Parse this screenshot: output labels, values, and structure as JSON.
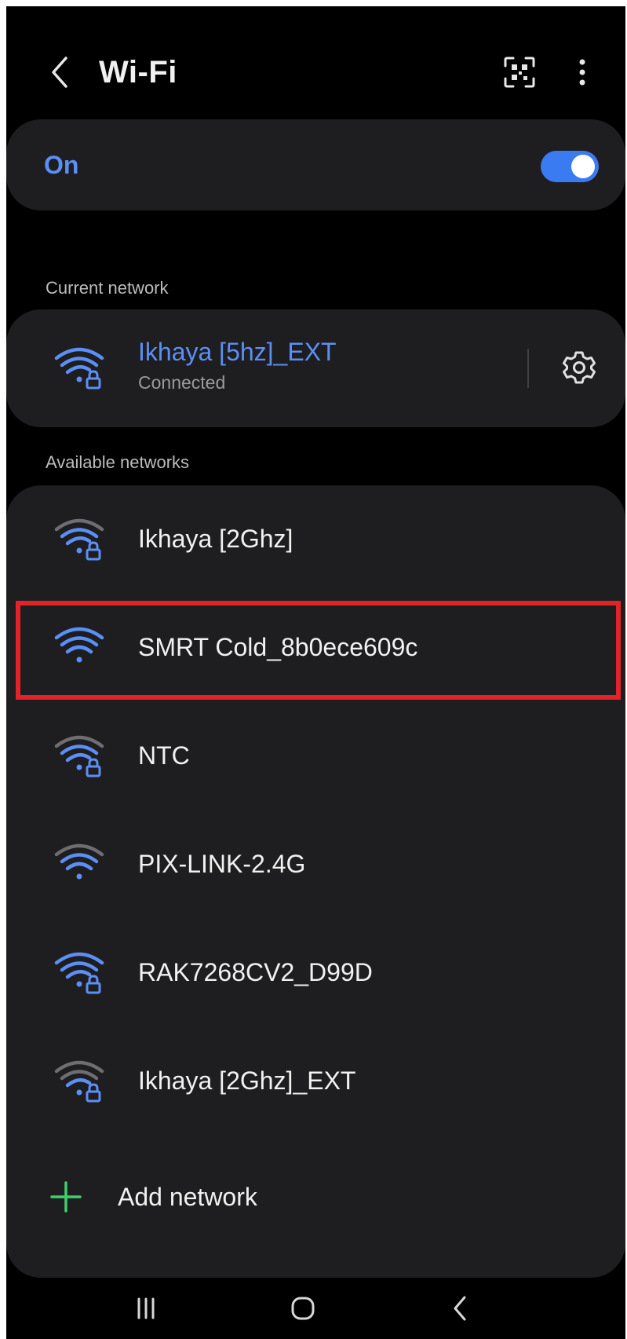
{
  "header": {
    "title": "Wi-Fi"
  },
  "wifi_toggle": {
    "label": "On",
    "enabled": true
  },
  "current_network": {
    "section_label": "Current network",
    "name": "Ikhaya [5hz]_EXT",
    "status": "Connected"
  },
  "available_networks": {
    "section_label": "Available networks",
    "items": [
      {
        "name": "Ikhaya [2Ghz]",
        "secured": true
      },
      {
        "name": "SMRT Cold_8b0ece609c",
        "secured": false
      },
      {
        "name": "NTC",
        "secured": true
      },
      {
        "name": "PIX-LINK-2.4G",
        "secured": false
      },
      {
        "name": "RAK7268CV2_D99D",
        "secured": true
      },
      {
        "name": "Ikhaya [2Ghz]_EXT",
        "secured": true
      }
    ],
    "add_label": "Add network"
  },
  "icons": {
    "back": "chevron-left-icon",
    "scan": "qr-scan-icon",
    "more": "more-vertical-icon",
    "settings": "gear-icon",
    "wifi": "wifi-icon",
    "lock": "lock-icon",
    "add": "plus-icon"
  },
  "colors": {
    "background": "#000000",
    "card": "#1e1e20",
    "accent": "#5c8ff5",
    "toggle": "#3a7bf2",
    "highlight": "#e2232a",
    "add_icon": "#3fcf6a"
  }
}
